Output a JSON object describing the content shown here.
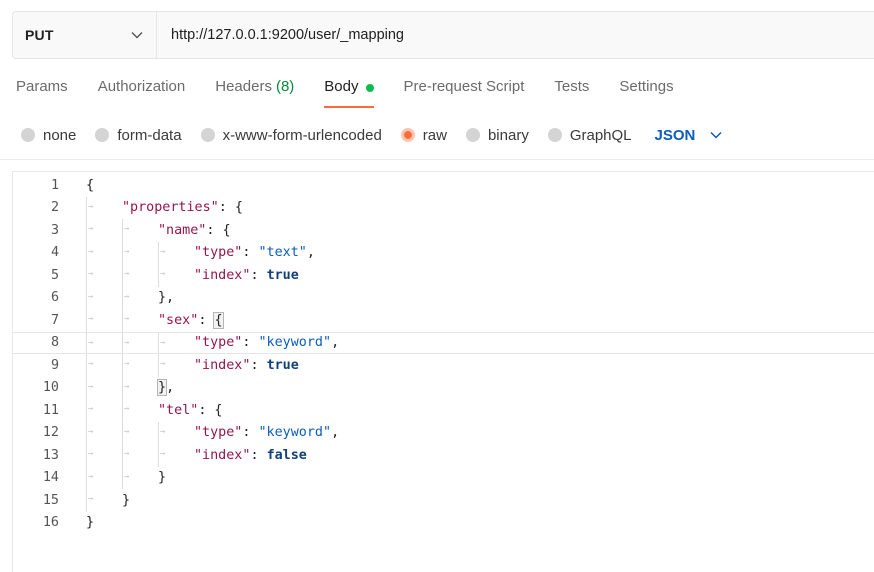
{
  "request": {
    "method": "PUT",
    "url": "http://127.0.0.1:9200/user/_mapping"
  },
  "tabs": [
    {
      "label": "Params"
    },
    {
      "label": "Authorization"
    },
    {
      "label": "Headers",
      "count": "(8)"
    },
    {
      "label": "Body",
      "active": true
    },
    {
      "label": "Pre-request Script"
    },
    {
      "label": "Tests"
    },
    {
      "label": "Settings"
    }
  ],
  "body_types": [
    {
      "label": "none"
    },
    {
      "label": "form-data"
    },
    {
      "label": "x-www-form-urlencoded"
    },
    {
      "label": "raw",
      "selected": true
    },
    {
      "label": "binary"
    },
    {
      "label": "GraphQL"
    }
  ],
  "language": "JSON",
  "colors": {
    "accent": "#ff6c37",
    "active_dot": "#0cbb52",
    "link_blue": "#0b5cbd",
    "key": "#97144d"
  },
  "editor": {
    "line_numbers": [
      "1",
      "2",
      "3",
      "4",
      "5",
      "6",
      "7",
      "8",
      "9",
      "10",
      "11",
      "12",
      "13",
      "14",
      "15",
      "16"
    ],
    "lines": [
      {
        "indent": 0,
        "tokens": [
          [
            "p",
            "{"
          ]
        ]
      },
      {
        "indent": 1,
        "tokens": [
          [
            "k",
            "\"properties\""
          ],
          [
            "p",
            ": {"
          ]
        ]
      },
      {
        "indent": 2,
        "tokens": [
          [
            "k",
            "\"name\""
          ],
          [
            "p",
            ": {"
          ]
        ]
      },
      {
        "indent": 3,
        "tokens": [
          [
            "k",
            "\"type\""
          ],
          [
            "p",
            ": "
          ],
          [
            "s",
            "\"text\""
          ],
          [
            "p",
            ","
          ]
        ]
      },
      {
        "indent": 3,
        "tokens": [
          [
            "k",
            "\"index\""
          ],
          [
            "p",
            ": "
          ],
          [
            "b",
            "true"
          ]
        ]
      },
      {
        "indent": 2,
        "tokens": [
          [
            "p",
            "},"
          ]
        ]
      },
      {
        "indent": 2,
        "tokens": [
          [
            "k",
            "\"sex\""
          ],
          [
            "p",
            ": "
          ],
          [
            "br",
            "{"
          ]
        ]
      },
      {
        "indent": 3,
        "tokens": [
          [
            "k",
            "\"type\""
          ],
          [
            "p",
            ": "
          ],
          [
            "s",
            "\"keyword\""
          ],
          [
            "p",
            ","
          ]
        ]
      },
      {
        "indent": 3,
        "tokens": [
          [
            "k",
            "\"index\""
          ],
          [
            "p",
            ": "
          ],
          [
            "b",
            "true"
          ]
        ]
      },
      {
        "indent": 2,
        "tokens": [
          [
            "br",
            "}"
          ],
          [
            "p",
            ","
          ]
        ]
      },
      {
        "indent": 2,
        "tokens": [
          [
            "k",
            "\"tel\""
          ],
          [
            "p",
            ": {"
          ]
        ]
      },
      {
        "indent": 3,
        "tokens": [
          [
            "k",
            "\"type\""
          ],
          [
            "p",
            ": "
          ],
          [
            "s",
            "\"keyword\""
          ],
          [
            "p",
            ","
          ]
        ]
      },
      {
        "indent": 3,
        "tokens": [
          [
            "k",
            "\"index\""
          ],
          [
            "p",
            ": "
          ],
          [
            "b",
            "false"
          ]
        ]
      },
      {
        "indent": 2,
        "tokens": [
          [
            "p",
            "}"
          ]
        ]
      },
      {
        "indent": 1,
        "tokens": [
          [
            "p",
            "}"
          ]
        ]
      },
      {
        "indent": 0,
        "tokens": [
          [
            "p",
            "}"
          ]
        ]
      }
    ]
  }
}
